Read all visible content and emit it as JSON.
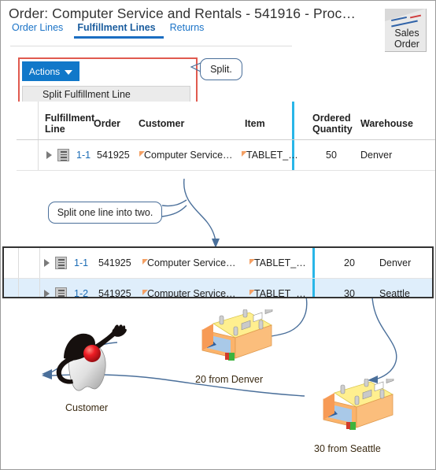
{
  "header": {
    "title": "Order: Computer Service and Rentals - 541916 - Proc…",
    "tabs": [
      {
        "label": "Order Lines",
        "active": false
      },
      {
        "label": "Fulfillment Lines",
        "active": true
      },
      {
        "label": "Returns",
        "active": false
      }
    ],
    "stamp": {
      "line1": "Sales",
      "line2": "Order"
    }
  },
  "toolbar": {
    "actions_label": "Actions",
    "menu_items": [
      "Split Fulfillment Line"
    ]
  },
  "callouts": {
    "split": "Split.",
    "split_one_line": "Split one line into two."
  },
  "table": {
    "columns": [
      {
        "label": "Fulfillment Line"
      },
      {
        "label": "Order"
      },
      {
        "label": "Customer"
      },
      {
        "label": "Item"
      },
      {
        "label": "Ordered Quantity"
      },
      {
        "label": "Warehouse"
      }
    ],
    "before_rows": [
      {
        "fulfillment_line": "1-1",
        "order": "541925",
        "customer": "Computer Service…",
        "item": "TABLET_…",
        "ordered_quantity": "50",
        "warehouse": "Denver",
        "selected": false
      }
    ],
    "after_rows": [
      {
        "fulfillment_line": "1-1",
        "order": "541925",
        "customer": "Computer Service…",
        "item": "TABLET_…",
        "ordered_quantity": "20",
        "warehouse": "Denver",
        "selected": false
      },
      {
        "fulfillment_line": "1-2",
        "order": "541925",
        "customer": "Computer Service…",
        "item": "TABLET_…",
        "ordered_quantity": "30",
        "warehouse": "Seattle",
        "selected": true
      }
    ]
  },
  "diagram": {
    "customer_label": "Customer",
    "warehouse_denver_label": "20 from  Denver",
    "warehouse_seattle_label": "30 from  Seattle"
  },
  "colors": {
    "accent_blue": "#1178c9",
    "link_blue": "#1a6bb5",
    "highlight_red": "#e05a4f",
    "row_selected": "#dfeefb",
    "frozen_divider": "#29b6e8",
    "arrow": "#4a6f9a",
    "warehouse_roof": "#ffef8f",
    "warehouse_wall": "#fbb36b"
  }
}
